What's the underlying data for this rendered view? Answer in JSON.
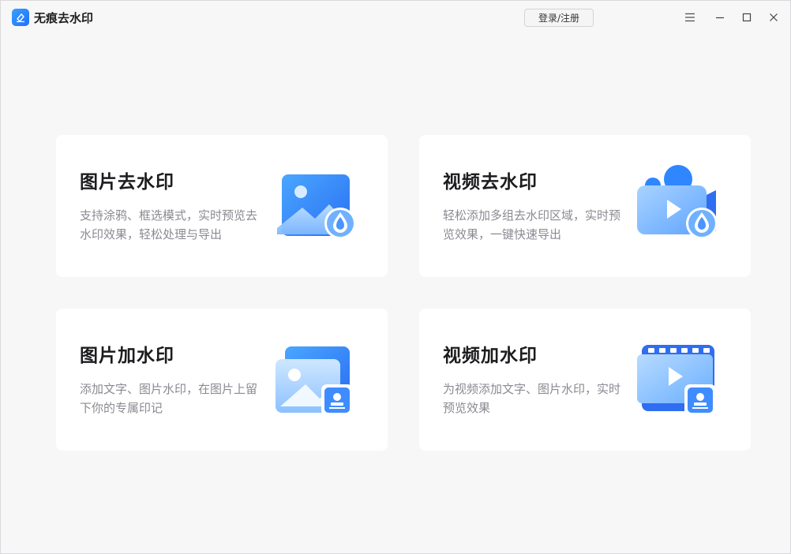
{
  "app": {
    "title": "无痕去水印",
    "logo_icon": "eraser-icon"
  },
  "header": {
    "login_label": "登录/注册",
    "controls": [
      "menu-icon",
      "minimize-icon",
      "maximize-icon",
      "close-icon"
    ]
  },
  "colors": {
    "accent": "#2f86ff",
    "accent_light": "#8ec8ff",
    "card_bg": "#ffffff",
    "page_bg": "#f7f7f8",
    "title_text": "#1c1c1f",
    "desc_text": "#8a8a92"
  },
  "cards": [
    {
      "title": "图片去水印",
      "desc": "支持涂鸦、框选模式，实时预览去水印效果，轻松处理与导出",
      "icon": "image-remove-watermark-icon"
    },
    {
      "title": "视频去水印",
      "desc": "轻松添加多组去水印区域，实时预览效果，一键快速导出",
      "icon": "video-remove-watermark-icon"
    },
    {
      "title": "图片加水印",
      "desc": "添加文字、图片水印，在图片上留下你的专属印记",
      "icon": "image-add-watermark-icon"
    },
    {
      "title": "视频加水印",
      "desc": "为视频添加文字、图片水印，实时预览效果",
      "icon": "video-add-watermark-icon"
    }
  ]
}
